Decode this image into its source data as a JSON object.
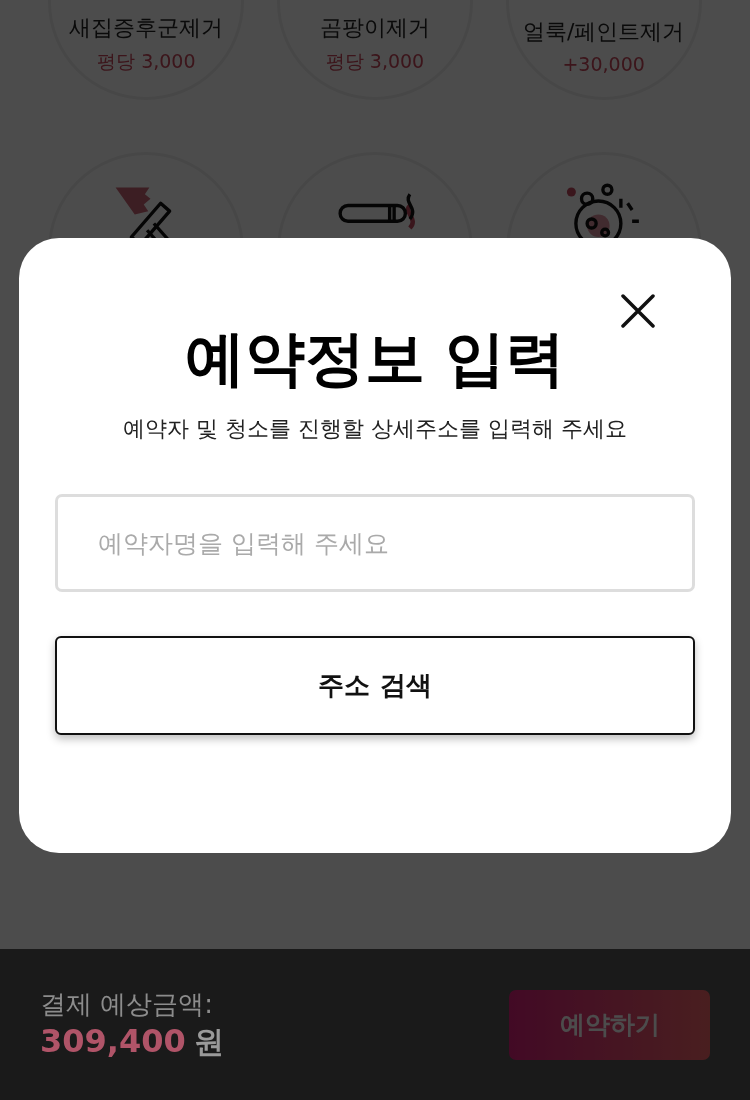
{
  "services": [
    {
      "label": "새집증후군제거",
      "price": "평당 3,000"
    },
    {
      "label": "곰팡이제거",
      "price": "평당 3,000"
    },
    {
      "label": "얼룩/페인트제거",
      "price": "+30,000"
    }
  ],
  "more_services": [
    {
      "kind": "squeegee"
    },
    {
      "kind": "cigarette"
    },
    {
      "kind": "germ"
    }
  ],
  "modal": {
    "title": "예약정보 입력",
    "subtitle": "예약자 및 청소를 진행할 상세주소를 입력해 주세요",
    "name_field": {
      "placeholder": "예약자명을 입력해 주세요"
    },
    "address_button": "주소 검색"
  },
  "footer": {
    "total_label": "결제 예상금액:",
    "total_amount": "309,400",
    "currency": "원",
    "book_button": "예약하기"
  }
}
